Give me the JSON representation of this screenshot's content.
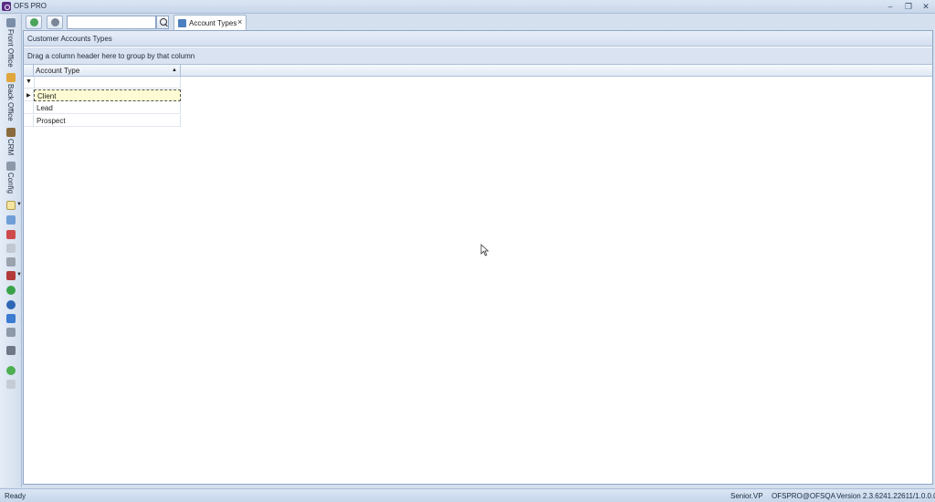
{
  "window": {
    "title": "OFS PRO"
  },
  "side_nav": [
    {
      "label": "Front Office",
      "icon": "front-office-icon"
    },
    {
      "label": "Back Office",
      "icon": "back-office-icon"
    },
    {
      "label": "CRM",
      "icon": "crm-icon"
    },
    {
      "label": "Config",
      "icon": "wrench-icon"
    }
  ],
  "toolbar": {
    "search_value": "",
    "tab_label": "Account Types",
    "tab_close": "×"
  },
  "panel": {
    "caption": "Customer Accounts Types",
    "group_hint": "Drag a column header here to group by that column"
  },
  "grid": {
    "column": "Account Type",
    "rows": [
      "Client",
      "Lead",
      "Prospect"
    ]
  },
  "status": {
    "left": "Ready",
    "user": "Senior.VP",
    "connection": "OFSPRO@OFSQA",
    "version": "Version 2.3.6241.22611/1.0.0.0"
  },
  "colors": {
    "accent": "#d5e0ee",
    "selected_row": "#fdfbd3",
    "app_icon": "#5a2c86"
  }
}
